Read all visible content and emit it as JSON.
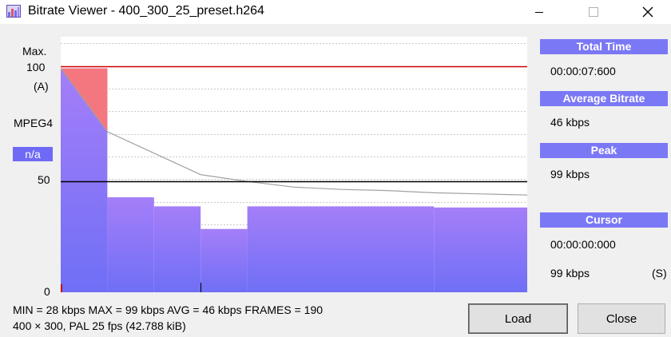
{
  "window": {
    "title": "Bitrate Viewer - 400_300_25_preset.h264",
    "icon": "bitrate-viewer-app-icon",
    "controls": [
      "minimize-icon",
      "maximize-icon",
      "close-icon"
    ]
  },
  "left_labels": {
    "max_label": "Max.",
    "max_value": "100",
    "mode": "(A)",
    "codec": "MPEG4",
    "badge": "n/a",
    "mid_tick": "50",
    "zero_tick": "0"
  },
  "chart_data": {
    "type": "bar",
    "title": "",
    "ylim": [
      0,
      113
    ],
    "y_ticks": [
      0,
      50,
      100
    ],
    "grid": true,
    "x_unit": "frames",
    "bars": [
      {
        "start": 0,
        "end": 19,
        "value": 99
      },
      {
        "start": 19,
        "end": 38,
        "value": 42
      },
      {
        "start": 38,
        "end": 57,
        "value": 38
      },
      {
        "start": 57,
        "end": 76,
        "value": 28
      },
      {
        "start": 76,
        "end": 152,
        "value": 38
      },
      {
        "start": 152,
        "end": 190,
        "value": 37.5
      }
    ],
    "average_curve": {
      "x": [
        0,
        19,
        38,
        57,
        76,
        95,
        114,
        133,
        152,
        171,
        190
      ],
      "y": [
        99,
        71,
        61.5,
        52,
        49,
        46.5,
        45.5,
        45,
        44,
        43.5,
        43
      ]
    },
    "max_line": 100,
    "average_line": 49,
    "cursor_x": 0,
    "x_tick_at": 57,
    "colors": {
      "plot_bg": "#ffffff",
      "bar_top": "#a57ef8",
      "bar_bottom": "#6f6ff6",
      "peak_fill": "#f4777f",
      "max_line": "#cc0000",
      "avg_line": "#000000",
      "curve": "#a0a0a0",
      "grid": "#c8c8c8"
    }
  },
  "panel": {
    "total_time": {
      "label": "Total Time",
      "value": "00:00:07:600"
    },
    "average_bitrate": {
      "label": "Average Bitrate",
      "value": "46 kbps"
    },
    "peak": {
      "label": "Peak",
      "value": "99 kbps"
    },
    "cursor": {
      "label": "Cursor",
      "time": "00:00:00:000",
      "value": "99 kbps",
      "flag": "(S)"
    }
  },
  "stats": {
    "line1": "MIN = 28 kbps  MAX = 99 kbps  AVG = 46 kbps  FRAMES = 190",
    "line2": "400 × 300, PAL 25 fps   (42.788 kiB)"
  },
  "buttons": {
    "load": "Load",
    "close": "Close"
  }
}
